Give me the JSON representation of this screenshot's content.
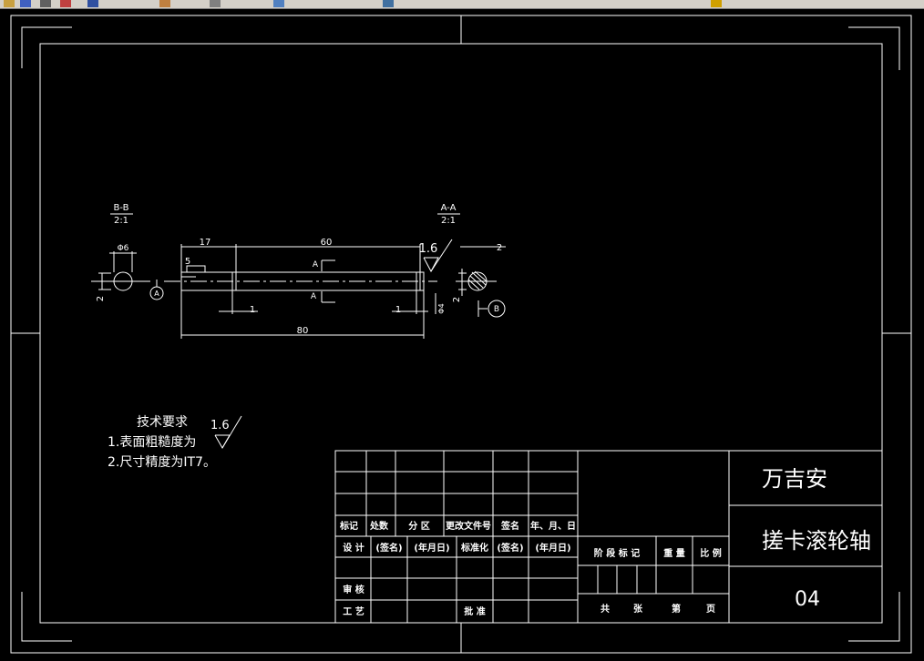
{
  "toolbar": {
    "icons": [
      "open-icon",
      "save-icon",
      "print-icon",
      "undo-icon",
      "redo-icon",
      "zoom-icon",
      "pan-icon",
      "properties-icon",
      "layer-icon",
      "color-icon"
    ]
  },
  "drawing": {
    "section_bb": {
      "label": "B-B",
      "scale": "2:1"
    },
    "section_aa": {
      "label": "A-A",
      "scale": "2:1"
    },
    "dims": {
      "phi6": "Φ6",
      "d17": "17",
      "d60": "60",
      "roughness": "1.6",
      "d2_right": "2",
      "d5": "5",
      "d2_left": "2",
      "d1_left": "1",
      "d1_right": "1",
      "d80": "80",
      "d04": "Φ4",
      "d2_sec": "2"
    },
    "section_marks": {
      "a_top": "A",
      "a_bot": "A",
      "circle_a": "A",
      "circle_b": "B"
    }
  },
  "tech": {
    "title": "技术要求",
    "roughness": "1.6",
    "line1": "1.表面粗糙度为",
    "line2": "2.尺寸精度为IT7。"
  },
  "titleblock": {
    "headers": [
      "标记",
      "处数",
      "分 区",
      "更改文件号",
      "签名",
      "年、月、日"
    ],
    "design_row": [
      "设 计",
      "(签名)",
      "(年月日)",
      "标准化",
      "(签名)",
      "(年月日)"
    ],
    "review": "审 核",
    "process": "工 艺",
    "approve": "批 准",
    "stage_row": [
      "阶 段 标 记",
      "重 量",
      "比 例"
    ],
    "sheet_row": [
      "共",
      "张",
      "第",
      "页"
    ],
    "name": "万吉安",
    "part": "搓卡滚轮轴",
    "number": "04"
  }
}
